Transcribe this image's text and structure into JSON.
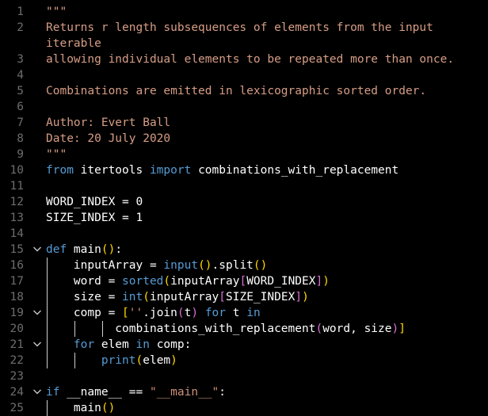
{
  "editor": {
    "lines": [
      {
        "n": "1",
        "fold": false,
        "guides": [],
        "tokens": [
          {
            "t": "\"\"\"",
            "c": "doc"
          }
        ]
      },
      {
        "n": "2",
        "fold": false,
        "guides": [],
        "tokens": [
          {
            "t": "Returns r length subsequences of elements from the input",
            "c": "doc"
          }
        ]
      },
      {
        "n": "",
        "fold": false,
        "guides": [],
        "tokens": [
          {
            "t": "iterable",
            "c": "doc"
          }
        ]
      },
      {
        "n": "3",
        "fold": false,
        "guides": [],
        "tokens": [
          {
            "t": "allowing individual elements to be repeated more than once.",
            "c": "doc"
          }
        ]
      },
      {
        "n": "4",
        "fold": false,
        "guides": [],
        "tokens": []
      },
      {
        "n": "5",
        "fold": false,
        "guides": [],
        "tokens": [
          {
            "t": "Combinations are emitted in lexicographic sorted order.",
            "c": "doc"
          }
        ]
      },
      {
        "n": "6",
        "fold": false,
        "guides": [],
        "tokens": []
      },
      {
        "n": "7",
        "fold": false,
        "guides": [],
        "tokens": [
          {
            "t": "Author: Evert Ball",
            "c": "doc"
          }
        ]
      },
      {
        "n": "8",
        "fold": false,
        "guides": [],
        "tokens": [
          {
            "t": "Date: 20 July 2020",
            "c": "doc"
          }
        ]
      },
      {
        "n": "9",
        "fold": false,
        "guides": [],
        "tokens": [
          {
            "t": "\"\"\"",
            "c": "doc"
          }
        ]
      },
      {
        "n": "10",
        "fold": false,
        "guides": [],
        "tokens": [
          {
            "t": "from",
            "c": "kw"
          },
          {
            "t": " itertools ",
            "c": "def"
          },
          {
            "t": "import",
            "c": "kw"
          },
          {
            "t": " combinations_with_replacement",
            "c": "def"
          }
        ]
      },
      {
        "n": "11",
        "fold": false,
        "guides": [],
        "tokens": []
      },
      {
        "n": "12",
        "fold": false,
        "guides": [],
        "tokens": [
          {
            "t": "WORD_INDEX = 0",
            "c": "def"
          }
        ]
      },
      {
        "n": "13",
        "fold": false,
        "guides": [],
        "tokens": [
          {
            "t": "SIZE_INDEX = 1",
            "c": "def"
          }
        ]
      },
      {
        "n": "14",
        "fold": false,
        "guides": [],
        "tokens": []
      },
      {
        "n": "15",
        "fold": true,
        "guides": [],
        "tokens": [
          {
            "t": "def",
            "c": "kw"
          },
          {
            "t": " main",
            "c": "def"
          },
          {
            "t": "()",
            "c": "br1"
          },
          {
            "t": ":",
            "c": "def"
          }
        ]
      },
      {
        "n": "16",
        "fold": false,
        "guides": [
          1
        ],
        "tokens": [
          {
            "t": "    inputArray = ",
            "c": "def"
          },
          {
            "t": "input",
            "c": "kw"
          },
          {
            "t": "()",
            "c": "br1"
          },
          {
            "t": ".split",
            "c": "def"
          },
          {
            "t": "()",
            "c": "br1"
          }
        ]
      },
      {
        "n": "17",
        "fold": false,
        "guides": [
          1
        ],
        "tokens": [
          {
            "t": "    word = ",
            "c": "def"
          },
          {
            "t": "sorted",
            "c": "kw"
          },
          {
            "t": "(",
            "c": "br1"
          },
          {
            "t": "inputArray",
            "c": "def"
          },
          {
            "t": "[",
            "c": "br2"
          },
          {
            "t": "WORD_INDEX",
            "c": "def"
          },
          {
            "t": "]",
            "c": "br2"
          },
          {
            "t": ")",
            "c": "br1"
          }
        ]
      },
      {
        "n": "18",
        "fold": false,
        "guides": [
          1
        ],
        "tokens": [
          {
            "t": "    size = ",
            "c": "def"
          },
          {
            "t": "int",
            "c": "kw"
          },
          {
            "t": "(",
            "c": "br1"
          },
          {
            "t": "inputArray",
            "c": "def"
          },
          {
            "t": "[",
            "c": "br2"
          },
          {
            "t": "SIZE_INDEX",
            "c": "def"
          },
          {
            "t": "]",
            "c": "br2"
          },
          {
            "t": ")",
            "c": "br1"
          }
        ]
      },
      {
        "n": "19",
        "fold": true,
        "guides": [
          1
        ],
        "tokens": [
          {
            "t": "    comp = ",
            "c": "def"
          },
          {
            "t": "[",
            "c": "br1"
          },
          {
            "t": "''",
            "c": "str"
          },
          {
            "t": ".join",
            "c": "def"
          },
          {
            "t": "(",
            "c": "br2"
          },
          {
            "t": "t",
            "c": "def"
          },
          {
            "t": ")",
            "c": "br2"
          },
          {
            "t": " for",
            "c": "kw"
          },
          {
            "t": " t ",
            "c": "def"
          },
          {
            "t": "in",
            "c": "kw"
          }
        ]
      },
      {
        "n": "20",
        "fold": false,
        "guides": [
          1,
          2,
          3
        ],
        "tokens": [
          {
            "t": "          combinations_with_replacement",
            "c": "def"
          },
          {
            "t": "(",
            "c": "br2"
          },
          {
            "t": "word, size",
            "c": "def"
          },
          {
            "t": ")",
            "c": "br2"
          },
          {
            "t": "]",
            "c": "br1"
          }
        ]
      },
      {
        "n": "21",
        "fold": true,
        "guides": [
          1
        ],
        "tokens": [
          {
            "t": "    for",
            "c": "kw"
          },
          {
            "t": " elem ",
            "c": "def"
          },
          {
            "t": "in",
            "c": "kw"
          },
          {
            "t": " comp:",
            "c": "def"
          }
        ]
      },
      {
        "n": "22",
        "fold": false,
        "guides": [
          1,
          2
        ],
        "tokens": [
          {
            "t": "        ",
            "c": "def"
          },
          {
            "t": "print",
            "c": "kw"
          },
          {
            "t": "(",
            "c": "br1"
          },
          {
            "t": "elem",
            "c": "def"
          },
          {
            "t": ")",
            "c": "br1"
          }
        ]
      },
      {
        "n": "23",
        "fold": false,
        "guides": [],
        "tokens": []
      },
      {
        "n": "24",
        "fold": true,
        "guides": [],
        "tokens": [
          {
            "t": "if",
            "c": "kw"
          },
          {
            "t": " __name__ == ",
            "c": "def"
          },
          {
            "t": "\"__main__\"",
            "c": "str"
          },
          {
            "t": ":",
            "c": "def"
          }
        ]
      },
      {
        "n": "25",
        "fold": false,
        "guides": [
          1
        ],
        "tokens": [
          {
            "t": "    main",
            "c": "def"
          },
          {
            "t": "()",
            "c": "br1"
          }
        ]
      }
    ]
  },
  "icons": {
    "fold": "chevron-down-icon"
  },
  "colors": {
    "background": "#000000",
    "line_number": "#6d6d6d",
    "docstring": "#d69d85",
    "keyword": "#569cd6",
    "string": "#ce9178",
    "bracket_level1": "#ffd700",
    "bracket_level2": "#da70d6",
    "text": "#ffffff"
  }
}
